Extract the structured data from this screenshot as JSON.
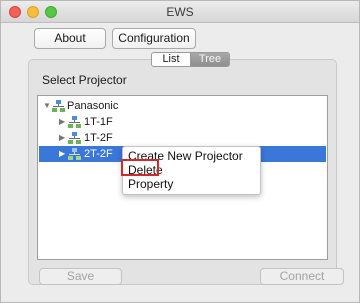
{
  "window": {
    "title": "EWS"
  },
  "toolbar": {
    "about_label": "About",
    "configuration_label": "Configuration"
  },
  "view_toggle": {
    "list_label": "List",
    "tree_label": "Tree",
    "selected": "Tree"
  },
  "group": {
    "label": "Select Projector"
  },
  "tree": {
    "root": {
      "label": "Panasonic",
      "icon": "network-icon",
      "expanded": true
    },
    "children": [
      {
        "label": "1T-1F",
        "icon": "network-icon",
        "expanded": false,
        "selected": false
      },
      {
        "label": "1T-2F",
        "icon": "network-icon",
        "expanded": false,
        "selected": false
      },
      {
        "label": "2T-2F",
        "icon": "network-icon",
        "expanded": false,
        "selected": true
      }
    ]
  },
  "context_menu": {
    "items": [
      {
        "label": "Create New Projector"
      },
      {
        "label": "Delete",
        "highlighted": true
      },
      {
        "label": "Property"
      }
    ]
  },
  "footer": {
    "save_label": "Save",
    "connect_label": "Connect"
  },
  "colors": {
    "selection": "#3b76d9",
    "highlight_box": "#d02b2b"
  }
}
